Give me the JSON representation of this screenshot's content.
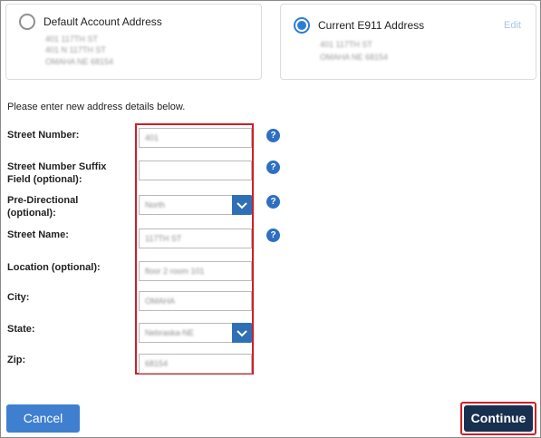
{
  "cards": {
    "default": {
      "title": "Default Account Address",
      "lines": [
        "401 117TH ST",
        "401 N 117TH ST",
        "OMAHA NE 68154"
      ],
      "selected": false
    },
    "current": {
      "title": "Current E911 Address",
      "lines": [
        "401 117TH ST",
        "OMAHA NE 68154"
      ],
      "edit_label": "Edit",
      "selected": true
    }
  },
  "form": {
    "intro": "Please enter new address details below.",
    "fields": [
      {
        "label": "Street Number:",
        "value": "401",
        "type": "text",
        "help": "?"
      },
      {
        "label": "Street Number Suffix\nField (optional):",
        "value": "",
        "type": "text",
        "help": "?"
      },
      {
        "label": "Pre-Directional\n(optional):",
        "value": "North",
        "type": "select",
        "help": "?"
      },
      {
        "label": "Street Name:",
        "value": "117TH ST",
        "type": "text",
        "help": "?"
      },
      {
        "label": "Location (optional):",
        "value": "floor 2 room 101",
        "type": "text"
      },
      {
        "label": "City:",
        "value": "OMAHA",
        "type": "text"
      },
      {
        "label": "State:",
        "value": "Nebraska-NE",
        "type": "select"
      },
      {
        "label": "Zip:",
        "value": "68154",
        "type": "text"
      }
    ]
  },
  "buttons": {
    "cancel": "Cancel",
    "continue": "Continue"
  },
  "colors": {
    "accent": "#2d7dd2",
    "highlight": "#d01f27",
    "continue_bg": "#18304f"
  }
}
